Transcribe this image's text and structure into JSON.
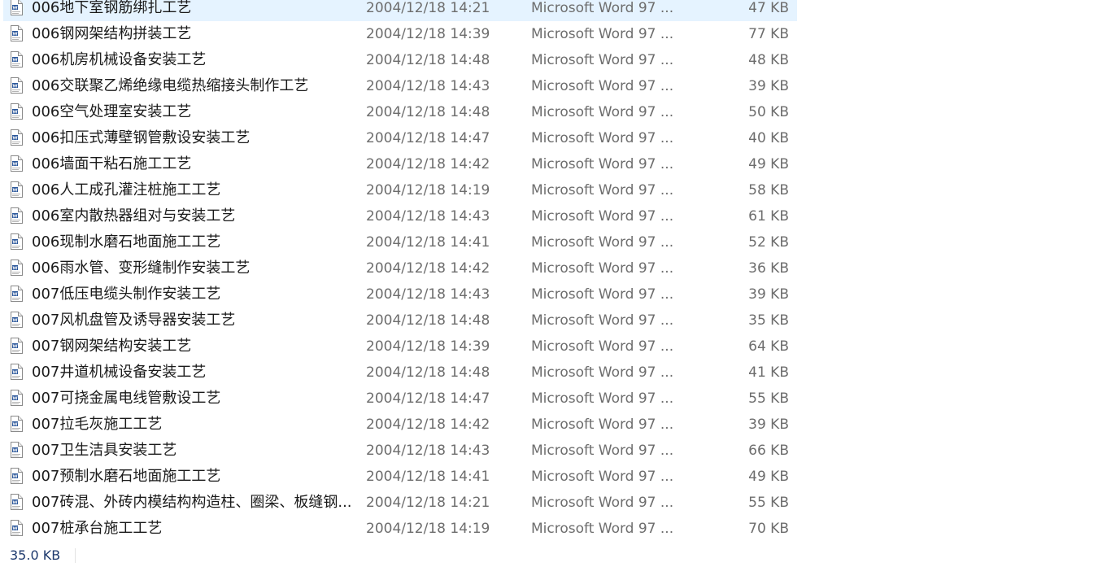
{
  "file_icon": "word-document-icon",
  "colors": {
    "selected_row": "#e5f3ff",
    "name_text": "#1a1a1a",
    "meta_text": "#6d6d6d",
    "status_text": "#1e3a6e"
  },
  "files": [
    {
      "name": "006地下室钢筋绑扎工艺",
      "date": "2004/12/18 14:21",
      "type": "Microsoft Word 97 ...",
      "size": "47 KB"
    },
    {
      "name": "006钢网架结构拼装工艺",
      "date": "2004/12/18 14:39",
      "type": "Microsoft Word 97 ...",
      "size": "77 KB"
    },
    {
      "name": "006机房机械设备安装工艺",
      "date": "2004/12/18 14:48",
      "type": "Microsoft Word 97 ...",
      "size": "48 KB"
    },
    {
      "name": "006交联聚乙烯绝缘电缆热缩接头制作工艺",
      "date": "2004/12/18 14:43",
      "type": "Microsoft Word 97 ...",
      "size": "39 KB"
    },
    {
      "name": "006空气处理室安装工艺",
      "date": "2004/12/18 14:48",
      "type": "Microsoft Word 97 ...",
      "size": "50 KB"
    },
    {
      "name": "006扣压式薄壁钢管敷设安装工艺",
      "date": "2004/12/18 14:47",
      "type": "Microsoft Word 97 ...",
      "size": "40 KB"
    },
    {
      "name": "006墙面干粘石施工工艺",
      "date": "2004/12/18 14:42",
      "type": "Microsoft Word 97 ...",
      "size": "49 KB"
    },
    {
      "name": "006人工成孔灌注桩施工工艺",
      "date": "2004/12/18 14:19",
      "type": "Microsoft Word 97 ...",
      "size": "58 KB"
    },
    {
      "name": "006室内散热器组对与安装工艺",
      "date": "2004/12/18 14:43",
      "type": "Microsoft Word 97 ...",
      "size": "61 KB"
    },
    {
      "name": "006现制水磨石地面施工工艺",
      "date": "2004/12/18 14:41",
      "type": "Microsoft Word 97 ...",
      "size": "52 KB"
    },
    {
      "name": "006雨水管、变形缝制作安装工艺",
      "date": "2004/12/18 14:42",
      "type": "Microsoft Word 97 ...",
      "size": "36 KB"
    },
    {
      "name": "007低压电缆头制作安装工艺",
      "date": "2004/12/18 14:43",
      "type": "Microsoft Word 97 ...",
      "size": "39 KB"
    },
    {
      "name": "007风机盘管及诱导器安装工艺",
      "date": "2004/12/18 14:48",
      "type": "Microsoft Word 97 ...",
      "size": "35 KB"
    },
    {
      "name": "007钢网架结构安装工艺",
      "date": "2004/12/18 14:39",
      "type": "Microsoft Word 97 ...",
      "size": "64 KB"
    },
    {
      "name": "007井道机械设备安装工艺",
      "date": "2004/12/18 14:48",
      "type": "Microsoft Word 97 ...",
      "size": "41 KB"
    },
    {
      "name": "007可挠金属电线管敷设工艺",
      "date": "2004/12/18 14:47",
      "type": "Microsoft Word 97 ...",
      "size": "55 KB"
    },
    {
      "name": "007拉毛灰施工工艺",
      "date": "2004/12/18 14:42",
      "type": "Microsoft Word 97 ...",
      "size": "39 KB"
    },
    {
      "name": "007卫生洁具安装工艺",
      "date": "2004/12/18 14:43",
      "type": "Microsoft Word 97 ...",
      "size": "66 KB"
    },
    {
      "name": "007预制水磨石地面施工工艺",
      "date": "2004/12/18 14:41",
      "type": "Microsoft Word 97 ...",
      "size": "49 KB"
    },
    {
      "name": "007砖混、外砖内模结构构造柱、圈梁、板缝钢...",
      "date": "2004/12/18 14:21",
      "type": "Microsoft Word 97 ...",
      "size": "55 KB"
    },
    {
      "name": "007桩承台施工工艺",
      "date": "2004/12/18 14:19",
      "type": "Microsoft Word 97 ...",
      "size": "70 KB"
    }
  ],
  "selected_index": 0,
  "status_bar": {
    "selected_size": "35.0 KB"
  }
}
